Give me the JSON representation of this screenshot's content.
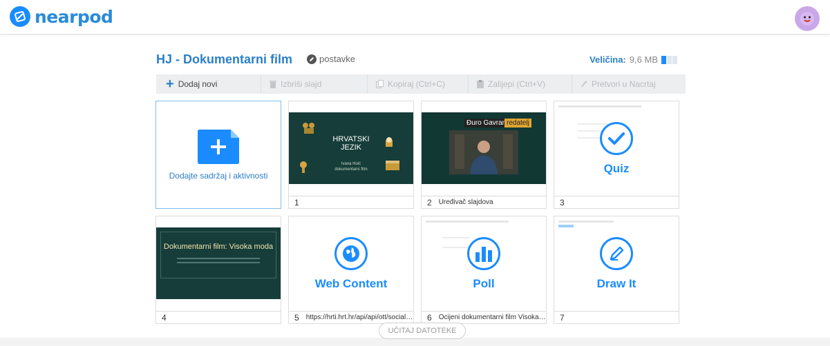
{
  "header": {
    "logo_text": "nearpod",
    "avatar_icon": "smiley-avatar-icon"
  },
  "lesson": {
    "title": "HJ - Dokumentarni film",
    "settings_label": "postavke",
    "size_label": "Veličina:",
    "size_value": "9,6 MB",
    "size_fraction": 0.33
  },
  "toolbar": {
    "add": "Dodaj novi",
    "delete": "Izbriši slajd",
    "copy": "Kopiraj (Ctrl+C)",
    "paste": "Zalijepi (Ctrl+V)",
    "convert": "Pretvori u Nacrtaj"
  },
  "add_card": {
    "label": "Dodajte sadržaj i aktivnosti"
  },
  "slides": [
    {
      "num": "1",
      "desc": "",
      "title_line1": "HRVATSKI",
      "title_line2": "JEZIK",
      "subtitle_line1": "Ivana Hoić",
      "subtitle_line2": "dokumentarni film"
    },
    {
      "num": "2",
      "desc": "Uređivač slajdova",
      "name": "Đuro Gavran",
      "role": "redatelj"
    },
    {
      "num": "3",
      "desc": "",
      "tile_label": "Quiz",
      "tile_icon": "checkmark-icon"
    },
    {
      "num": "4",
      "desc": "",
      "title": "Dokumentarni film: Visoka moda"
    },
    {
      "num": "5",
      "desc": "https://hrti.hrt.hr/api/api/ott/socials...",
      "tile_label": "Web Content",
      "tile_icon": "globe-icon"
    },
    {
      "num": "6",
      "desc": "Ocijeni dokumentarni film Visoka ...",
      "tile_label": "Poll",
      "tile_icon": "bar-chart-icon"
    },
    {
      "num": "7",
      "desc": "",
      "tile_label": "Draw It",
      "tile_icon": "pencil-icon"
    }
  ],
  "upload_button": "UČITAJ DATOTEKE",
  "colors": {
    "accent": "#1a8cff",
    "title_blue": "#2b7fc7",
    "slide_dark": "#163d3a"
  }
}
